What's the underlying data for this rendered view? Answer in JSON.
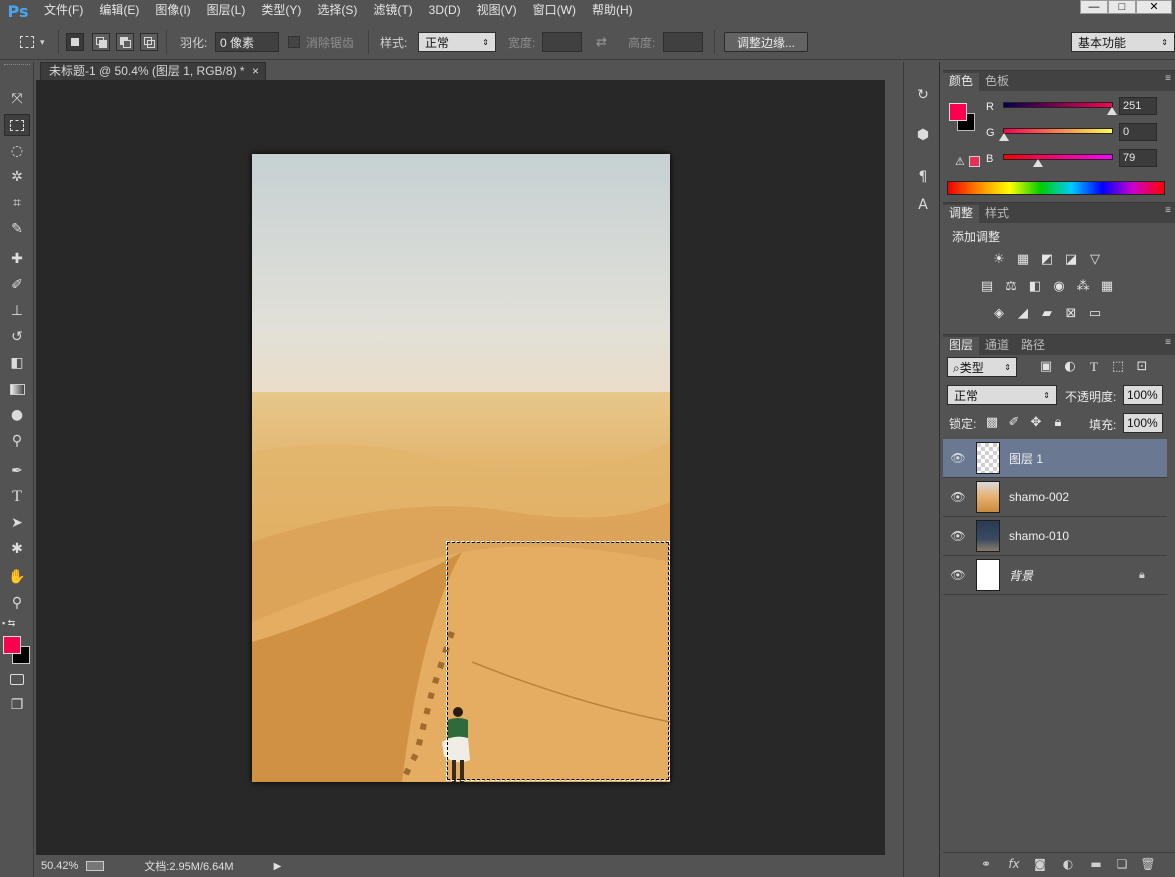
{
  "app": {
    "logo": "Ps"
  },
  "menu": [
    "文件(F)",
    "编辑(E)",
    "图像(I)",
    "图层(L)",
    "类型(Y)",
    "选择(S)",
    "滤镜(T)",
    "3D(D)",
    "视图(V)",
    "窗口(W)",
    "帮助(H)"
  ],
  "window_controls": {
    "minimize": "—",
    "maximize": "□",
    "close": "✕"
  },
  "options": {
    "feather_label": "羽化:",
    "feather_value": "0 像素",
    "antialias_label": "消除锯齿",
    "style_label": "样式:",
    "style_value": "正常",
    "width_label": "宽度:",
    "swap_icon": "⇄",
    "height_label": "高度:",
    "refine_edge": "调整边缘...",
    "workspace": "基本功能"
  },
  "document": {
    "tab_title": "未标题-1 @ 50.4% (图层 1, RGB/8) *",
    "close": "×"
  },
  "status": {
    "zoom": "50.42%",
    "doc": "文档:2.95M/6.64M"
  },
  "color_panel": {
    "tabs": [
      "颜色",
      "色板"
    ],
    "channels": [
      {
        "label": "R",
        "value": "251",
        "level": 0.984
      },
      {
        "label": "G",
        "value": "0",
        "level": 0.0
      },
      {
        "label": "B",
        "value": "79",
        "level": 0.31
      }
    ],
    "fg_color": "#fb004f",
    "bg_color": "#000000"
  },
  "adjust_panel": {
    "tabs": [
      "调整",
      "样式"
    ],
    "title": "添加调整"
  },
  "layers_panel": {
    "tabs": [
      "图层",
      "通道",
      "路径"
    ],
    "filter_label": "类型",
    "blend_mode": "正常",
    "opacity_label": "不透明度:",
    "opacity_value": "100%",
    "lock_label": "锁定:",
    "fill_label": "填充:",
    "fill_value": "100%",
    "layers": [
      {
        "name": "图层 1",
        "selected": true
      },
      {
        "name": "shamo-002",
        "selected": false
      },
      {
        "name": "shamo-010",
        "selected": false
      },
      {
        "name": "背景",
        "selected": false,
        "locked": true
      }
    ]
  }
}
